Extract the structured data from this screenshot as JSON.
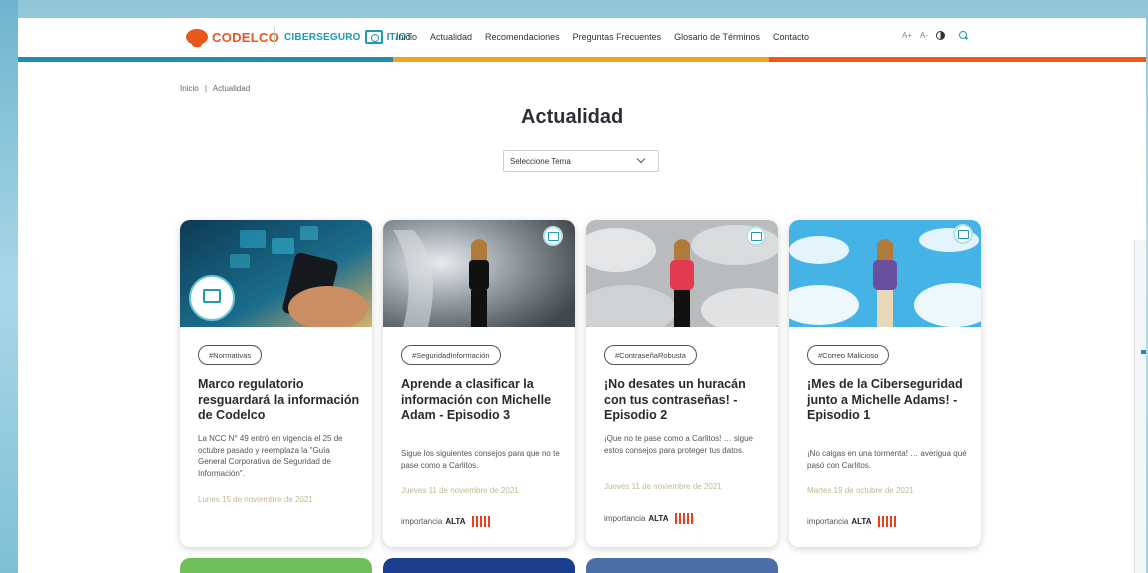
{
  "header": {
    "brand": "CODELCO",
    "sub_brand": "CIBERSEGURO",
    "sub_brand_suffix": "IT/OT",
    "nav": [
      "Inicio",
      "Actualidad",
      "Recomendaciones",
      "Preguntas Frecuentes",
      "Glosario de Términos",
      "Contacto"
    ],
    "tools": {
      "font_up": "A+",
      "font_down": "A-"
    }
  },
  "breadcrumb": {
    "home": "Inicio",
    "separator": "|",
    "current": "Actualidad"
  },
  "page_title": "Actualidad",
  "topic_select": {
    "value": "Seleccione Tema"
  },
  "cards": [
    {
      "tag": "#Normativas",
      "title": "Marco regulatorio resguardará la información de Codelco",
      "desc": "La NCC N° 49 entró en vigencia el 25 de octubre pasado y reemplaza la \"Guía General Corporativa de Seguridad de Información\".",
      "date": "Lunes 15 de noviembre de 2021"
    },
    {
      "tag": "#SeguridadInformación",
      "title": "Aprende a clasificar la información con Michelle Adam - Episodio 3",
      "desc": "Sigue los siguientes consejos para que no te pase como a Carlitos.",
      "date": "Jueves 11 de noviembre de 2021",
      "importance_label": "importancia",
      "importance_level": "ALTA"
    },
    {
      "tag": "#ContraseñaRobusta",
      "title": "¡No desates un huracán con tus contraseñas! - Episodio 2",
      "desc": "¡Que no te pase como a Carlitos! … sigue estos consejos para proteger tus datos.",
      "date": "Jueves 11 de noviembre de 2021",
      "importance_label": "importancia",
      "importance_level": "ALTA"
    },
    {
      "tag": "#Correo Malicioso",
      "title": "¡Mes de la Ciberseguridad junto a Michelle Adams! - Episodio 1",
      "desc": "¡No caigas en una tormenta! … averigua qué pasó con Carlitos.",
      "date": "Martes 19 de octubre de 2021",
      "importance_label": "importancia",
      "importance_level": "ALTA"
    }
  ],
  "colors": {
    "brand_orange": "#e8581c",
    "brand_teal": "#1f9ab0",
    "bar_teal": "#1d8fa8",
    "bar_yellow": "#f2a51f",
    "bar_orange": "#ee5a1a",
    "importance_red": "#e8401c"
  }
}
